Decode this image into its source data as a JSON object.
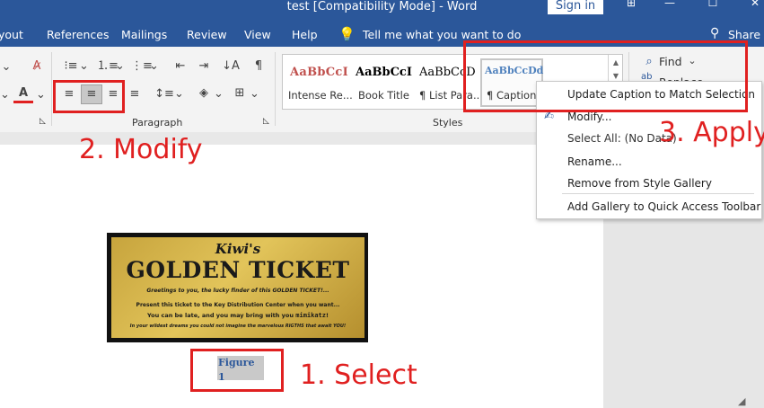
{
  "window": {
    "title": "test [Compatibility Mode] - Word",
    "sign_in": "Sign in",
    "share": "Share"
  },
  "tabs": [
    "yout",
    "References",
    "Mailings",
    "Review",
    "View",
    "Help"
  ],
  "tell_me": "Tell me what you want to do",
  "ribbon": {
    "paragraph_label": "Paragraph",
    "styles_label": "Styles",
    "find_label": "Find",
    "replace_label": "Replace",
    "styles": [
      {
        "sample": "AaBbCcI",
        "name": "Intense Re...",
        "color": "#c0504d"
      },
      {
        "sample": "AaBbCcI",
        "name": "Book Title",
        "color": "#000000"
      },
      {
        "sample": "AaBbCcD",
        "name": "¶ List Para...",
        "color": "#000000"
      },
      {
        "sample": "AaBbCcDd",
        "name": "¶ Caption",
        "color": "#4f81bd"
      }
    ]
  },
  "context_menu": {
    "items": [
      "Update Caption to Match Selection",
      "Modify...",
      "Select All: (No Data)",
      "Rename...",
      "Remove from Style Gallery",
      "Add Gallery to Quick Access Toolbar"
    ]
  },
  "annotations": {
    "select": "1. Select",
    "modify": "2. Modify",
    "apply": "3. Apply"
  },
  "ticket": {
    "brand": "Kiwi's",
    "headline": "GOLDEN TICKET",
    "line1": "Greetings to you, the lucky finder of this GOLDEN TICKET!...",
    "line2": "Present this ticket to the Key Distribution Center when you want...",
    "line3a": "You can be late, and you may bring with you ",
    "line3b": "mimikatz",
    "line3c": "!",
    "line4": "In your wildest dreams you could not imagine the marvelous RIGTHS that await YOU!"
  },
  "document": {
    "caption": "Figure 1"
  },
  "colors": {
    "accent": "#2b579a",
    "annotation_red": "#e02020"
  }
}
